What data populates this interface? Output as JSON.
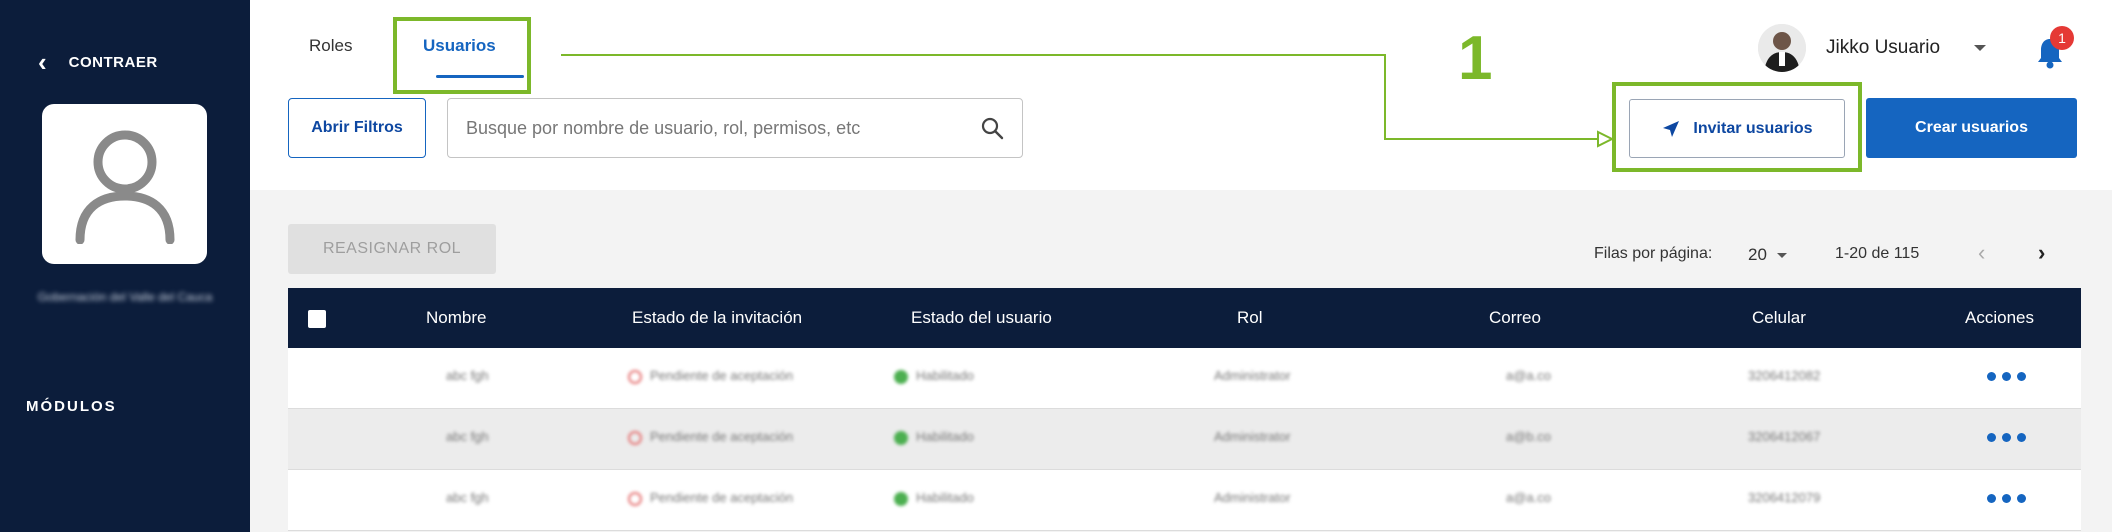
{
  "sidebar": {
    "collapse_label": "CONTRAER",
    "org_name": "Gobernación del Valle del Cauca",
    "modules_label": "MÓDULOS"
  },
  "header": {
    "tabs": [
      {
        "label": "Roles"
      },
      {
        "label": "Usuarios",
        "active": true
      }
    ],
    "filter_button": "Abrir Filtros",
    "search_placeholder": "Busque por nombre de usuario, rol, permisos, etc",
    "user_name": "Jikko Usuario",
    "notification_count": "1",
    "invite_button": "Invitar usuarios",
    "create_button": "Crear usuarios",
    "step_number": "1"
  },
  "toolbar": {
    "reassign_button": "REASIGNAR ROL",
    "rows_per_page_label": "Filas por página:",
    "rows_per_page_value": "20",
    "range_text": "1-20 de 115"
  },
  "table": {
    "columns": [
      "Nombre",
      "Estado de la invitación",
      "Estado del usuario",
      "Rol",
      "Correo",
      "Celular",
      "Acciones"
    ],
    "rows": [
      {
        "name": "abc fgh",
        "invite_status": "Pendiente de aceptación",
        "user_status": "Habilitado",
        "role": "Administrator",
        "email": "a@a.co",
        "phone": "3206412082"
      },
      {
        "name": "abc fgh",
        "invite_status": "Pendiente de aceptación",
        "user_status": "Habilitado",
        "role": "Administrator",
        "email": "a@b.co",
        "phone": "3206412067"
      },
      {
        "name": "abc fgh",
        "invite_status": "Pendiente de aceptación",
        "user_status": "Habilitado",
        "role": "Administrator",
        "email": "a@a.co",
        "phone": "3206412079"
      }
    ]
  },
  "colors": {
    "sidebar_bg": "#0c1d3b",
    "primary": "#1565c0",
    "highlight": "#7cb82a",
    "badge": "#e53935"
  }
}
